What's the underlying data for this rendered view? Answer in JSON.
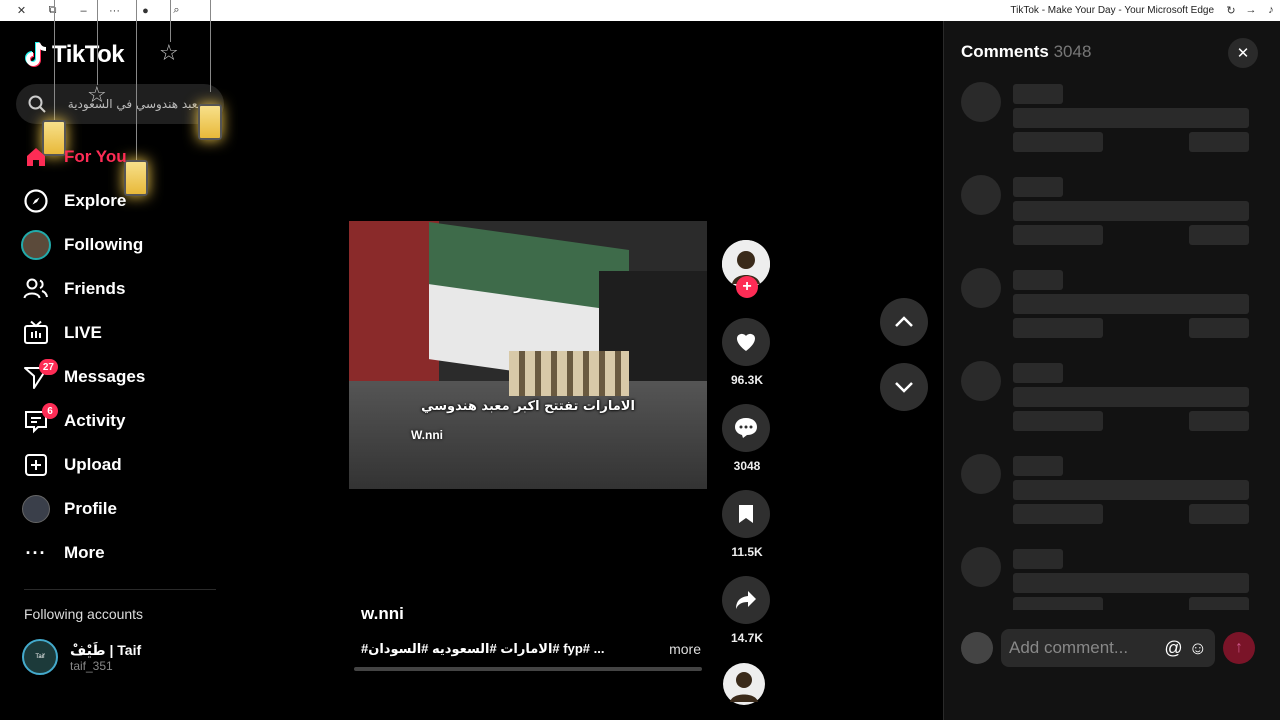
{
  "window": {
    "title": "TikTok - Make Your Day - Your Microsoft Edge"
  },
  "app": {
    "logo_text": "TikTok"
  },
  "search": {
    "value": "معبد هندوسي في السعودية"
  },
  "nav": [
    {
      "label": "For You",
      "icon": "home-icon"
    },
    {
      "label": "Explore",
      "icon": "compass-icon"
    },
    {
      "label": "Following",
      "icon": "following-avatar"
    },
    {
      "label": "Friends",
      "icon": "friends-icon"
    },
    {
      "label": "LIVE",
      "icon": "live-tv-icon"
    },
    {
      "label": "Messages",
      "icon": "messages-icon",
      "badge": "27"
    },
    {
      "label": "Activity",
      "icon": "activity-icon",
      "badge": "6"
    },
    {
      "label": "Upload",
      "icon": "upload-icon"
    },
    {
      "label": "Profile",
      "icon": "profile-avatar"
    },
    {
      "label": "More",
      "icon": "more-icon"
    }
  ],
  "following_accounts": {
    "heading": "Following accounts",
    "items": [
      {
        "name": "طَيْفْ | Taif",
        "handle": "taif_351",
        "avatar_text": "Taif"
      }
    ]
  },
  "video": {
    "caption_overlay": "الامارات تفتتح اكبر معبد هندوسي",
    "watermark": "W.nni",
    "author": "w.nni",
    "description": "#الامارات #السعوديه #السودان# fyp# ...",
    "more_label": "more"
  },
  "actions": {
    "likes": "96.3K",
    "comments": "3048",
    "saves": "11.5K",
    "shares": "14.7K"
  },
  "comments_panel": {
    "title": "Comments",
    "count": "3048",
    "input_placeholder": "Add comment..."
  },
  "colors": {
    "accent": "#fe2c55",
    "panel_bg": "#121212",
    "skeleton": "#2a2a2a"
  }
}
